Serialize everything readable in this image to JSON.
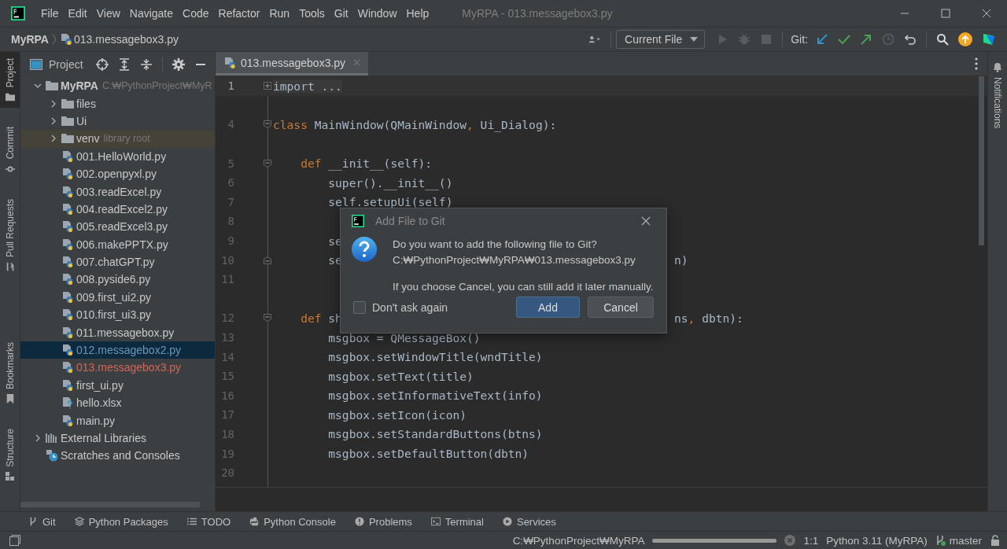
{
  "window": {
    "title": "MyRPA - 013.messagebox3.py"
  },
  "menu": [
    "File",
    "Edit",
    "View",
    "Navigate",
    "Code",
    "Refactor",
    "Run",
    "Tools",
    "Git",
    "Window",
    "Help"
  ],
  "breadcrumb": {
    "project": "MyRPA",
    "file": "013.messagebox3.py"
  },
  "toolbar": {
    "run_config": "Current File",
    "git_label": "Git:"
  },
  "left_stripe_top": [
    {
      "label": "Project",
      "selected": true,
      "kind": "folder"
    },
    {
      "label": "Commit",
      "selected": false,
      "kind": "commit"
    },
    {
      "label": "Pull Requests",
      "selected": false,
      "kind": "pull"
    }
  ],
  "left_stripe_bottom": [
    {
      "label": "Bookmarks",
      "selected": false,
      "kind": "bookmark"
    },
    {
      "label": "Structure",
      "selected": false,
      "kind": "structure"
    }
  ],
  "right_stripe": {
    "label": "Notifications"
  },
  "project_panel": {
    "title": "Project",
    "tree": [
      {
        "label": "MyRPA",
        "note": "C:₩PythonProject₩MyR",
        "kind": "root",
        "expanded": true,
        "selected": false,
        "children": [
          {
            "label": "files",
            "kind": "folder",
            "expanded": false,
            "selected": false
          },
          {
            "label": "Ui",
            "kind": "folder",
            "expanded": false,
            "selected": false
          },
          {
            "label": "venv",
            "note": "library root",
            "kind": "library",
            "expanded": false,
            "selected": false
          },
          {
            "label": "001.HelloWorld.py",
            "kind": "python",
            "selected": false
          },
          {
            "label": "002.openpyxl.py",
            "kind": "python",
            "selected": false
          },
          {
            "label": "003.readExcel.py",
            "kind": "python",
            "selected": false
          },
          {
            "label": "004.readExcel2.py",
            "kind": "python",
            "selected": false
          },
          {
            "label": "005.readExcel3.py",
            "kind": "python",
            "selected": false
          },
          {
            "label": "006.makePPTX.py",
            "kind": "python",
            "selected": false
          },
          {
            "label": "007.chatGPT.py",
            "kind": "python",
            "selected": false
          },
          {
            "label": "008.pyside6.py",
            "kind": "python",
            "selected": false
          },
          {
            "label": "009.first_ui2.py",
            "kind": "python",
            "selected": false
          },
          {
            "label": "010.first_ui3.py",
            "kind": "python",
            "selected": false
          },
          {
            "label": "011.messagebox.py",
            "kind": "python",
            "selected": false
          },
          {
            "label": "012.messagebox2.py",
            "kind": "python",
            "color": "#6897bb",
            "selected": true
          },
          {
            "label": "013.messagebox3.py",
            "kind": "python",
            "color": "#d1675a",
            "selected": false
          },
          {
            "label": "first_ui.py",
            "kind": "python",
            "selected": false
          },
          {
            "label": "hello.xlsx",
            "kind": "unknown",
            "selected": false
          },
          {
            "label": "main.py",
            "kind": "python",
            "selected": false
          }
        ]
      },
      {
        "label": "External Libraries",
        "kind": "libraries",
        "expanded": false,
        "selected": false
      },
      {
        "label": "Scratches and Consoles",
        "kind": "scratches",
        "selected": false
      }
    ]
  },
  "editor": {
    "tabs": [
      {
        "label": "013.messagebox3.py",
        "selected": true
      }
    ],
    "lines": [
      {
        "kind": "code",
        "number": "1",
        "current": true,
        "collapsed": true,
        "segments": [
          {
            "text": "import ...",
            "kind": "folded"
          }
        ]
      },
      {
        "kind": "spacer"
      },
      {
        "kind": "code",
        "number": "4",
        "current": false,
        "fold_start": true,
        "segments": [
          {
            "text": "class",
            "kind": "keyword"
          },
          {
            "text": " MainWindow(QMainWindow",
            "kind": "plain"
          },
          {
            "text": ",",
            "kind": "keyword"
          },
          {
            "text": " Ui_Dialog):",
            "kind": "plain"
          }
        ]
      },
      {
        "kind": "spacer"
      },
      {
        "kind": "code",
        "number": "5",
        "current": false,
        "fold_start": true,
        "segments": [
          {
            "text": "    def",
            "kind": "keyword"
          },
          {
            "text": " __init__(self):",
            "kind": "plain"
          }
        ]
      },
      {
        "kind": "code",
        "number": "6",
        "current": false,
        "segments": [
          {
            "text": "        super().__init__()",
            "kind": "plain"
          }
        ]
      },
      {
        "kind": "code",
        "number": "7",
        "current": false,
        "segments": [
          {
            "text": "        self.setupUi(self)",
            "kind": "plain"
          }
        ]
      },
      {
        "kind": "code",
        "number": "8",
        "current": false
      },
      {
        "kind": "code",
        "number": "9",
        "current": false,
        "segments": [
          {
            "text": "        se",
            "kind": "plain"
          }
        ]
      },
      {
        "kind": "code",
        "number": "10",
        "current": false,
        "fold_end": true,
        "segments": [
          {
            "text": "        se",
            "kind": "plain"
          }
        ],
        "tail": [
          {
            "text": "n)",
            "kind": "plain"
          }
        ]
      },
      {
        "kind": "code",
        "number": "11",
        "current": false
      },
      {
        "kind": "spacer"
      },
      {
        "kind": "code",
        "number": "12",
        "current": false,
        "fold_start": true,
        "segments": [
          {
            "text": "    def",
            "kind": "keyword"
          },
          {
            "text": " sh",
            "kind": "plain"
          }
        ],
        "tail": [
          {
            "text": "ns",
            "kind": "plain"
          },
          {
            "text": ",",
            "kind": "keyword"
          },
          {
            "text": " dbtn):",
            "kind": "plain"
          }
        ]
      },
      {
        "kind": "code",
        "number": "13",
        "current": false,
        "segments": [
          {
            "text": "        msgbox = QMessageBox()",
            "kind": "plain"
          }
        ]
      },
      {
        "kind": "code",
        "number": "14",
        "current": false,
        "segments": [
          {
            "text": "        msgbox.setWindowTitle(wndTitle)",
            "kind": "plain"
          }
        ]
      },
      {
        "kind": "code",
        "number": "15",
        "current": false,
        "segments": [
          {
            "text": "        msgbox.setText(title)",
            "kind": "plain"
          }
        ]
      },
      {
        "kind": "code",
        "number": "16",
        "current": false,
        "segments": [
          {
            "text": "        msgbox.setInformativeText(info)",
            "kind": "plain"
          }
        ]
      },
      {
        "kind": "code",
        "number": "17",
        "current": false,
        "segments": [
          {
            "text": "        msgbox.setIcon(icon)",
            "kind": "plain"
          }
        ]
      },
      {
        "kind": "code",
        "number": "18",
        "current": false,
        "segments": [
          {
            "text": "        msgbox.setStandardButtons(btns)",
            "kind": "plain"
          }
        ]
      },
      {
        "kind": "code",
        "number": "19",
        "current": false,
        "segments": [
          {
            "text": "        msgbox.setDefaultButton(dbtn)",
            "kind": "plain"
          }
        ]
      },
      {
        "kind": "code",
        "number": "20",
        "current": false
      }
    ]
  },
  "dialog": {
    "title": "Add File to Git",
    "question": "Do you want to add the following file to Git?",
    "path": "C:₩PythonProject₩MyRPA₩013.messagebox3.py",
    "hint": "If you choose Cancel, you can still add it later manually.",
    "checkbox": {
      "label": "Don't ask again",
      "checked": false
    },
    "buttons": [
      {
        "label": "Add",
        "kind": "primary"
      },
      {
        "label": "Cancel",
        "kind": "secondary"
      }
    ]
  },
  "tool_windows": [
    {
      "label": "Git",
      "kind": "git"
    },
    {
      "label": "Python Packages",
      "kind": "packages"
    },
    {
      "label": "TODO",
      "kind": "todo"
    },
    {
      "label": "Python Console",
      "kind": "console"
    },
    {
      "label": "Problems",
      "kind": "problems"
    },
    {
      "label": "Terminal",
      "kind": "terminal"
    },
    {
      "label": "Services",
      "kind": "services"
    }
  ],
  "status_bar": {
    "task": "C:₩PythonProject₩MyRPA",
    "progress": {
      "level": 1
    },
    "position": "1:1",
    "interpreter": "Python 3.11 (MyRPA)",
    "branch": "master"
  }
}
